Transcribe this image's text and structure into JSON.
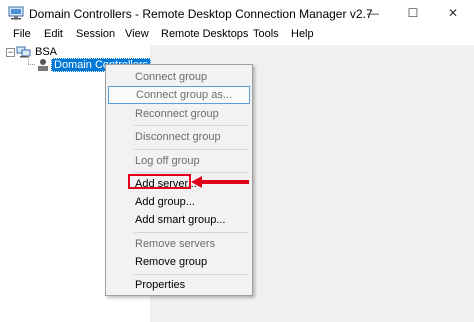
{
  "window": {
    "title": "Domain Controllers - Remote Desktop Connection Manager v2.7",
    "minimize_glyph": "—",
    "maximize_glyph": "☐",
    "close_glyph": "✕"
  },
  "menu": [
    {
      "label": "File"
    },
    {
      "label": "Edit"
    },
    {
      "label": "Session"
    },
    {
      "label": "View"
    },
    {
      "label": "Remote Desktops"
    },
    {
      "label": "Tools"
    },
    {
      "label": "Help"
    }
  ],
  "tree": {
    "expander_glyph": "−",
    "root": {
      "label": "BSA",
      "icon": "servers-group-icon"
    },
    "child": {
      "label": "Domain Controllers",
      "icon": "group-icon",
      "selected": true
    }
  },
  "context_menu": {
    "items": [
      {
        "label": "Connect group",
        "enabled": false
      },
      {
        "label": "Connect group as...",
        "enabled": false,
        "hover": true
      },
      {
        "label": "Reconnect group",
        "enabled": false
      },
      {
        "label": "Disconnect group",
        "enabled": false
      },
      {
        "label": "Log off group",
        "enabled": false
      },
      {
        "label": "Add server...",
        "enabled": true,
        "highlighted": true
      },
      {
        "label": "Add group...",
        "enabled": true
      },
      {
        "label": "Add smart group...",
        "enabled": true
      },
      {
        "label": "Remove servers",
        "enabled": false
      },
      {
        "label": "Remove group",
        "enabled": true
      },
      {
        "label": "Properties",
        "enabled": true
      }
    ]
  },
  "annotation": {
    "color": "#e2001a",
    "target": "Add server..."
  },
  "colors": {
    "selection": "#0078d7",
    "menu_hover_border": "#5aa0e0"
  }
}
